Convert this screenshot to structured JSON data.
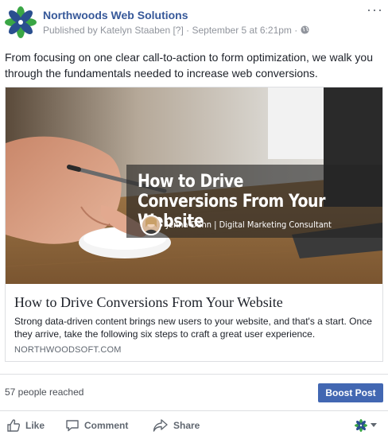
{
  "post": {
    "page_name": "Northwoods Web Solutions",
    "published_by": "Published by Katelyn Staaben",
    "help_marker": "[?]",
    "separator": "·",
    "timestamp": "September 5 at 6:21pm",
    "more_label": "···",
    "text": "From focusing on one clear call-to-action to form optimization, we walk you through the fundamentals needed to increase web conversions."
  },
  "link_card": {
    "image_title": "How to Drive Conversions From Your Website",
    "image_author": "Jenna Dehn | Digital Marketing Consultant",
    "title": "How to Drive Conversions From Your Website",
    "description": "Strong data-driven content brings new users to your website, and that's a start. Once they arrive, take the following six steps to craft a great user experience.",
    "domain": "NORTHWOODSOFT.COM"
  },
  "stats": {
    "reach": "57 people reached",
    "boost_label": "Boost Post"
  },
  "actions": {
    "like": "Like",
    "comment": "Comment",
    "share": "Share"
  },
  "colors": {
    "link_blue": "#365899",
    "button_blue": "#4267b2",
    "logo_green": "#3aa645",
    "logo_blue": "#2a4f8f"
  },
  "icons": {
    "globe": "globe-icon",
    "like": "thumbs-up-icon",
    "comment": "comment-bubble-icon",
    "share": "share-arrow-icon",
    "audience": "page-logo-icon",
    "dropdown": "caret-down-icon"
  }
}
